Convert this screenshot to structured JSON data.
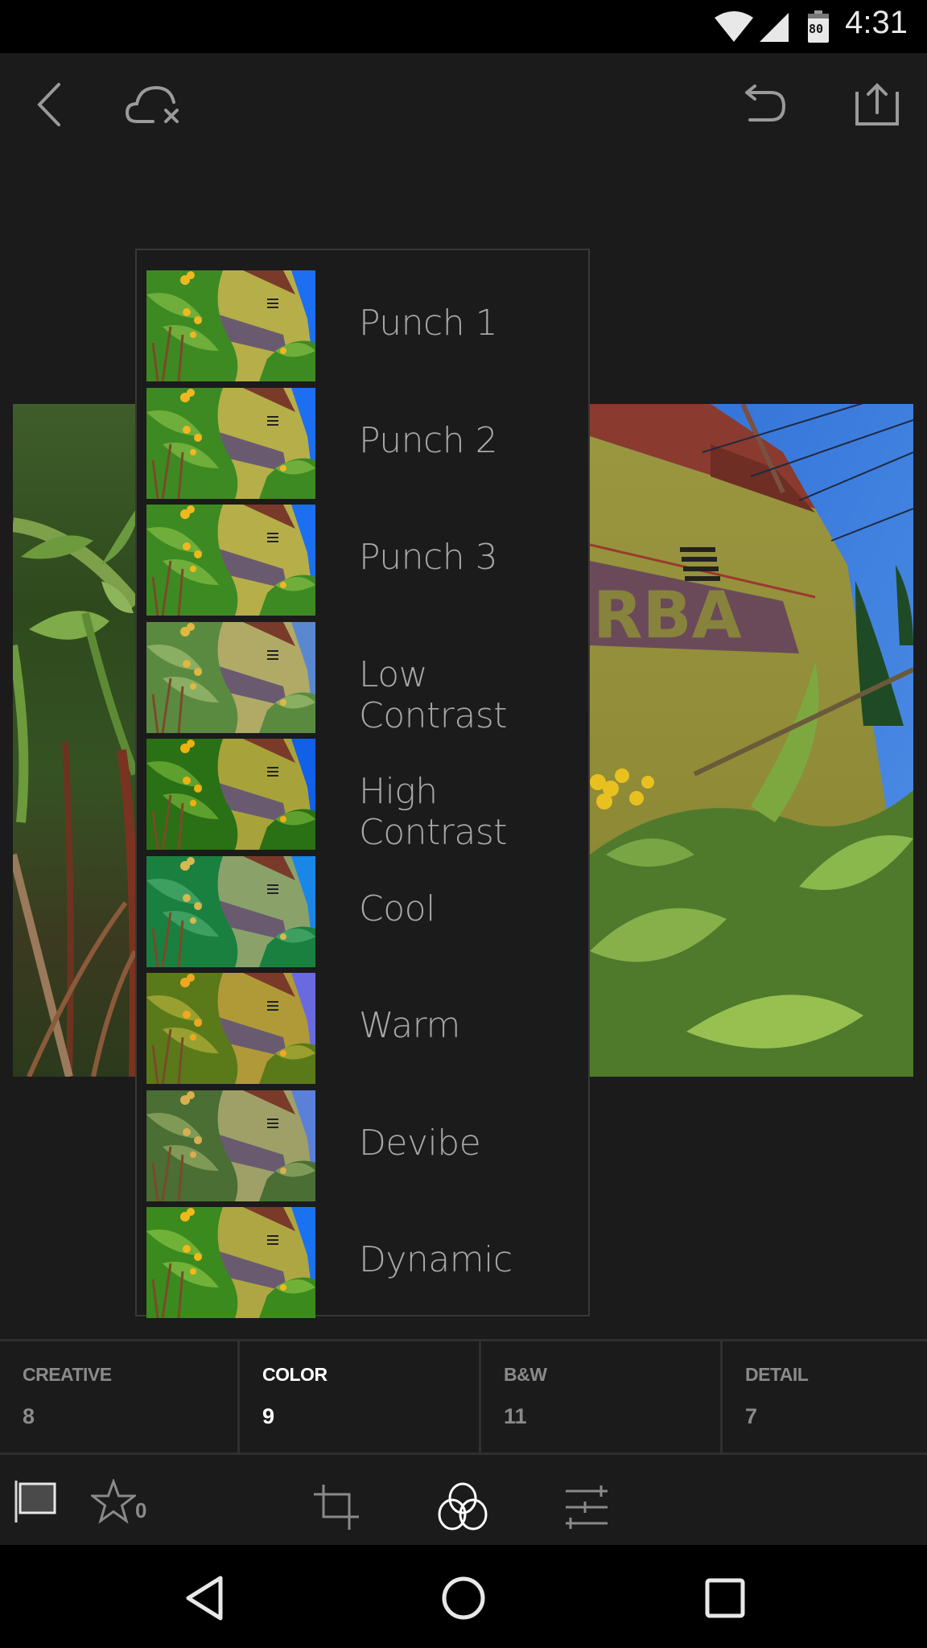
{
  "status_bar": {
    "time": "4:31",
    "battery_level": "80",
    "icons": [
      "wifi-icon",
      "cell-signal-icon",
      "battery-icon"
    ]
  },
  "toolbar": {
    "left_icons": [
      "back-chevron-icon",
      "cloud-sync-off-icon"
    ],
    "right_icons": [
      "undo-icon",
      "share-icon"
    ]
  },
  "presets": {
    "category": "COLOR",
    "items": [
      {
        "label": "Punch 1",
        "tint": "punch"
      },
      {
        "label": "Punch 2",
        "tint": "punch"
      },
      {
        "label": "Punch 3",
        "tint": "punch"
      },
      {
        "label": "Low Contrast",
        "tint": "low"
      },
      {
        "label": "High Contrast",
        "tint": "high"
      },
      {
        "label": "Cool",
        "tint": "cool"
      },
      {
        "label": "Warm",
        "tint": "warm"
      },
      {
        "label": "Devibe",
        "tint": "devibe"
      },
      {
        "label": "Dynamic",
        "tint": "dynamic"
      }
    ]
  },
  "categories": [
    {
      "name": "CREATIVE",
      "count": "8",
      "active": false
    },
    {
      "name": "COLOR",
      "count": "9",
      "active": true
    },
    {
      "name": "B&W",
      "count": "11",
      "active": false
    },
    {
      "name": "DETAIL",
      "count": "7",
      "active": false
    }
  ],
  "tools": {
    "flag": "flag-icon",
    "rating_stars": "0",
    "items": [
      "crop-icon",
      "presets-icon",
      "adjustments-icon"
    ],
    "active": "presets-icon"
  },
  "nav_bar": [
    "nav-back-icon",
    "nav-home-icon",
    "nav-recents-icon"
  ]
}
